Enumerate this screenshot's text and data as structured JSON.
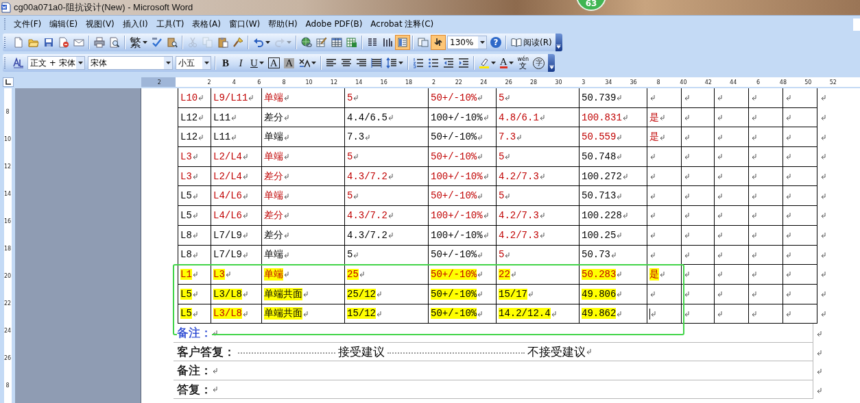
{
  "window": {
    "title": "cg00a071a0-阻抗设计(New) - Microsoft Word"
  },
  "badge": {
    "text": "63"
  },
  "menu": [
    "文件(F)",
    "编辑(E)",
    "视图(V)",
    "插入(I)",
    "工具(T)",
    "表格(A)",
    "窗口(W)",
    "帮助(H)",
    "Adobe PDF(B)",
    "Acrobat 注释(C)"
  ],
  "toolbar_standard": [
    {
      "kind": "new",
      "pressed": false,
      "disabled": false
    },
    {
      "kind": "open",
      "pressed": false,
      "disabled": false
    },
    {
      "kind": "save",
      "pressed": false,
      "disabled": false
    },
    {
      "kind": "permission",
      "pressed": false,
      "disabled": false
    },
    {
      "kind": "email",
      "pressed": false,
      "disabled": false
    },
    {
      "kind": "separator"
    },
    {
      "kind": "print",
      "pressed": false,
      "disabled": false
    },
    {
      "kind": "preview",
      "pressed": false,
      "disabled": false
    },
    {
      "kind": "separator"
    },
    {
      "kind": "glyph",
      "label": "繁",
      "dropdown": true,
      "pressed": false,
      "disabled": false
    },
    {
      "kind": "spell",
      "pressed": false,
      "disabled": false
    },
    {
      "kind": "research",
      "pressed": false,
      "disabled": false
    },
    {
      "kind": "separator"
    },
    {
      "kind": "cut",
      "pressed": false,
      "disabled": true
    },
    {
      "kind": "copy",
      "pressed": false,
      "disabled": true
    },
    {
      "kind": "paste",
      "pressed": false,
      "disabled": false
    },
    {
      "kind": "painter",
      "pressed": false,
      "disabled": false
    },
    {
      "kind": "separator"
    },
    {
      "kind": "undo",
      "dropdown": true,
      "pressed": false,
      "disabled": false
    },
    {
      "kind": "redo",
      "dropdown": true,
      "pressed": false,
      "disabled": true
    },
    {
      "kind": "separator"
    },
    {
      "kind": "hyperlink",
      "pressed": false,
      "disabled": false
    },
    {
      "kind": "tables",
      "pressed": false,
      "disabled": false
    },
    {
      "kind": "table",
      "pressed": false,
      "disabled": false
    },
    {
      "kind": "sheet",
      "pressed": false,
      "disabled": false
    },
    {
      "kind": "separator"
    },
    {
      "kind": "columns",
      "pressed": false,
      "disabled": false
    },
    {
      "kind": "drawing",
      "pressed": false,
      "disabled": false
    },
    {
      "kind": "docmap",
      "pressed": true,
      "disabled": false
    },
    {
      "kind": "separator"
    },
    {
      "kind": "thumbs",
      "pressed": false,
      "disabled": false
    },
    {
      "kind": "showhide",
      "pressed": true,
      "disabled": false
    },
    {
      "kind": "combo",
      "value": "130%"
    },
    {
      "kind": "help",
      "label": "?",
      "pressed": false,
      "disabled": false
    },
    {
      "kind": "separator"
    },
    {
      "kind": "read",
      "label": "阅读(R)",
      "pressed": false,
      "disabled": false
    }
  ],
  "toolbar_formatting": [
    {
      "kind": "styles"
    },
    {
      "kind": "combo",
      "value": "正文 + 宋体"
    },
    {
      "kind": "combo",
      "value": "宋体"
    },
    {
      "kind": "combo",
      "value": "小五"
    },
    {
      "kind": "separator"
    },
    {
      "kind": "bold",
      "label": "B"
    },
    {
      "kind": "italic",
      "label": "I"
    },
    {
      "kind": "underline",
      "label": "U",
      "dropdown": true
    },
    {
      "kind": "boxed",
      "label": "A"
    },
    {
      "kind": "shaded",
      "label": "A"
    },
    {
      "kind": "scale",
      "dropdown": true
    },
    {
      "kind": "separator"
    },
    {
      "kind": "left"
    },
    {
      "kind": "center"
    },
    {
      "kind": "right"
    },
    {
      "kind": "justify"
    },
    {
      "kind": "spacing",
      "dropdown": true
    },
    {
      "kind": "separator"
    },
    {
      "kind": "numbering"
    },
    {
      "kind": "bullets"
    },
    {
      "kind": "outdent"
    },
    {
      "kind": "indent"
    },
    {
      "kind": "separator"
    },
    {
      "kind": "highlight",
      "dropdown": true
    },
    {
      "kind": "fontcolor",
      "label": "A",
      "dropdown": true
    },
    {
      "kind": "phonetic",
      "top": "wén",
      "label": "文"
    },
    {
      "kind": "enclosed",
      "label": "字"
    }
  ],
  "ruler": {
    "labels": [
      "2",
      "2",
      "4",
      "6",
      "8",
      "10",
      "12",
      "14",
      "16",
      "18",
      "2",
      "22",
      "24",
      "26",
      "28",
      "30",
      "3",
      "34",
      "36",
      "8",
      "40",
      "42",
      "44",
      "6",
      "48",
      "50",
      "52"
    ]
  },
  "vertical_ruler": {
    "labels": [
      "8",
      "10",
      "12",
      "14",
      "16",
      "18",
      "20",
      "22",
      "24",
      "26",
      "8"
    ]
  },
  "table": {
    "formatting_marks": true,
    "rows": [
      {
        "cells": [
          {
            "kind": "text",
            "text": "L10",
            "red": true,
            "highlight": false
          },
          {
            "kind": "text",
            "text": "L9/L11",
            "red": true,
            "highlight": false
          },
          {
            "kind": "text",
            "text": "单端",
            "red": true,
            "highlight": false
          },
          {
            "kind": "text",
            "text": "5",
            "red": true,
            "highlight": false
          },
          {
            "kind": "text",
            "text": "50+/-10%",
            "red": true,
            "highlight": false
          },
          {
            "kind": "text",
            "text": "5",
            "red": true,
            "highlight": false
          },
          {
            "kind": "text",
            "text": "50.739",
            "red": false,
            "highlight": false
          },
          {
            "kind": "blank"
          },
          {
            "kind": "blank"
          },
          {
            "kind": "blank"
          },
          {
            "kind": "blank"
          },
          {
            "kind": "blank"
          }
        ]
      },
      {
        "cells": [
          {
            "kind": "text",
            "text": "L12",
            "red": false,
            "highlight": false
          },
          {
            "kind": "text",
            "text": "L11",
            "red": false,
            "highlight": false
          },
          {
            "kind": "text",
            "text": "差分",
            "red": false,
            "highlight": false
          },
          {
            "kind": "text",
            "text": "4.4/6.5",
            "red": false,
            "highlight": false
          },
          {
            "kind": "text",
            "text": "100+/-10%",
            "red": false,
            "highlight": false
          },
          {
            "kind": "text",
            "text": "4.8/6.1",
            "red": true,
            "highlight": false
          },
          {
            "kind": "text",
            "text": "100.831",
            "red": true,
            "highlight": false
          },
          {
            "kind": "text",
            "text": "是",
            "red": true,
            "highlight": false
          },
          {
            "kind": "blank"
          },
          {
            "kind": "blank"
          },
          {
            "kind": "blank"
          },
          {
            "kind": "blank"
          }
        ]
      },
      {
        "cells": [
          {
            "kind": "text",
            "text": "L12",
            "red": false,
            "highlight": false
          },
          {
            "kind": "text",
            "text": "L11",
            "red": false,
            "highlight": false
          },
          {
            "kind": "text",
            "text": "单端",
            "red": false,
            "highlight": false
          },
          {
            "kind": "text",
            "text": "7.3",
            "red": false,
            "highlight": false
          },
          {
            "kind": "text",
            "text": "50+/-10%",
            "red": false,
            "highlight": false
          },
          {
            "kind": "text",
            "text": "7.3",
            "red": true,
            "highlight": false
          },
          {
            "kind": "text",
            "text": "50.559",
            "red": true,
            "highlight": false
          },
          {
            "kind": "text",
            "text": "是",
            "red": true,
            "highlight": false
          },
          {
            "kind": "blank"
          },
          {
            "kind": "blank"
          },
          {
            "kind": "blank"
          },
          {
            "kind": "blank"
          }
        ]
      },
      {
        "cells": [
          {
            "kind": "text",
            "text": "L3",
            "red": true,
            "highlight": false
          },
          {
            "kind": "text",
            "text": "L2/L4",
            "red": true,
            "highlight": false
          },
          {
            "kind": "text",
            "text": "单端",
            "red": true,
            "highlight": false
          },
          {
            "kind": "text",
            "text": "5",
            "red": true,
            "highlight": false
          },
          {
            "kind": "text",
            "text": "50+/-10%",
            "red": true,
            "highlight": false
          },
          {
            "kind": "text",
            "text": "5",
            "red": true,
            "highlight": false
          },
          {
            "kind": "text",
            "text": "50.748",
            "red": false,
            "highlight": false
          },
          {
            "kind": "blank"
          },
          {
            "kind": "blank"
          },
          {
            "kind": "blank"
          },
          {
            "kind": "blank"
          },
          {
            "kind": "blank"
          }
        ]
      },
      {
        "cells": [
          {
            "kind": "text",
            "text": "L3",
            "red": true,
            "highlight": false
          },
          {
            "kind": "text",
            "text": "L2/L4",
            "red": true,
            "highlight": false
          },
          {
            "kind": "text",
            "text": "差分",
            "red": true,
            "highlight": false
          },
          {
            "kind": "text",
            "text": "4.3/7.2",
            "red": true,
            "highlight": false
          },
          {
            "kind": "text",
            "text": "100+/-10%",
            "red": true,
            "highlight": false
          },
          {
            "kind": "text",
            "text": "4.2/7.3",
            "red": true,
            "highlight": false
          },
          {
            "kind": "text",
            "text": "100.272",
            "red": false,
            "highlight": false
          },
          {
            "kind": "blank"
          },
          {
            "kind": "blank"
          },
          {
            "kind": "blank"
          },
          {
            "kind": "blank"
          },
          {
            "kind": "blank"
          }
        ]
      },
      {
        "cells": [
          {
            "kind": "text",
            "text": "L5",
            "red": false,
            "highlight": false
          },
          {
            "kind": "text",
            "text": "L4/L6",
            "red": true,
            "highlight": false
          },
          {
            "kind": "text",
            "text": "单端",
            "red": true,
            "highlight": false
          },
          {
            "kind": "text",
            "text": "5",
            "red": true,
            "highlight": false
          },
          {
            "kind": "text",
            "text": "50+/-10%",
            "red": true,
            "highlight": false
          },
          {
            "kind": "text",
            "text": "5",
            "red": true,
            "highlight": false
          },
          {
            "kind": "text",
            "text": "50.713",
            "red": false,
            "highlight": false
          },
          {
            "kind": "blank"
          },
          {
            "kind": "blank"
          },
          {
            "kind": "blank"
          },
          {
            "kind": "blank"
          },
          {
            "kind": "blank"
          }
        ]
      },
      {
        "cells": [
          {
            "kind": "text",
            "text": "L5",
            "red": false,
            "highlight": false
          },
          {
            "kind": "text",
            "text": "L4/L6",
            "red": true,
            "highlight": false
          },
          {
            "kind": "text",
            "text": "差分",
            "red": true,
            "highlight": false
          },
          {
            "kind": "text",
            "text": "4.3/7.2",
            "red": true,
            "highlight": false
          },
          {
            "kind": "text",
            "text": "100+/-10%",
            "red": true,
            "highlight": false
          },
          {
            "kind": "text",
            "text": "4.2/7.3",
            "red": true,
            "highlight": false
          },
          {
            "kind": "text",
            "text": "100.228",
            "red": false,
            "highlight": false
          },
          {
            "kind": "blank"
          },
          {
            "kind": "blank"
          },
          {
            "kind": "blank"
          },
          {
            "kind": "blank"
          },
          {
            "kind": "blank"
          }
        ]
      },
      {
        "cells": [
          {
            "kind": "text",
            "text": "L8",
            "red": false,
            "highlight": false
          },
          {
            "kind": "text",
            "text": "L7/L9",
            "red": false,
            "highlight": false
          },
          {
            "kind": "text",
            "text": "差分",
            "red": false,
            "highlight": false
          },
          {
            "kind": "text",
            "text": "4.3/7.2",
            "red": false,
            "highlight": false
          },
          {
            "kind": "text",
            "text": "100+/-10%",
            "red": false,
            "highlight": false
          },
          {
            "kind": "text",
            "text": "4.2/7.3",
            "red": true,
            "highlight": false
          },
          {
            "kind": "text",
            "text": "100.25",
            "red": false,
            "highlight": false
          },
          {
            "kind": "blank"
          },
          {
            "kind": "blank"
          },
          {
            "kind": "blank"
          },
          {
            "kind": "blank"
          },
          {
            "kind": "blank"
          }
        ]
      },
      {
        "cells": [
          {
            "kind": "text",
            "text": "L8",
            "red": false,
            "highlight": false
          },
          {
            "kind": "text",
            "text": "L7/L9",
            "red": false,
            "highlight": false
          },
          {
            "kind": "text",
            "text": "单端",
            "red": false,
            "highlight": false
          },
          {
            "kind": "text",
            "text": "5",
            "red": false,
            "highlight": false
          },
          {
            "kind": "text",
            "text": "50+/-10%",
            "red": false,
            "highlight": false
          },
          {
            "kind": "text",
            "text": "5",
            "red": true,
            "highlight": false
          },
          {
            "kind": "text",
            "text": "50.73",
            "red": false,
            "highlight": false
          },
          {
            "kind": "blank"
          },
          {
            "kind": "blank"
          },
          {
            "kind": "blank"
          },
          {
            "kind": "blank"
          },
          {
            "kind": "blank"
          }
        ]
      },
      {
        "cells": [
          {
            "kind": "text",
            "text": "L1",
            "red": true,
            "highlight": true
          },
          {
            "kind": "text",
            "text": "L3",
            "red": true,
            "highlight": true
          },
          {
            "kind": "text",
            "text": "单端",
            "red": true,
            "highlight": true
          },
          {
            "kind": "text",
            "text": "25",
            "red": true,
            "highlight": true
          },
          {
            "kind": "text",
            "text": "50+/-10%",
            "red": true,
            "highlight": true
          },
          {
            "kind": "text",
            "text": "22",
            "red": true,
            "highlight": true
          },
          {
            "kind": "text",
            "text": "50.283",
            "red": true,
            "highlight": true
          },
          {
            "kind": "text",
            "text": "是",
            "red": true,
            "highlight": true
          },
          {
            "kind": "blank"
          },
          {
            "kind": "blank"
          },
          {
            "kind": "blank"
          },
          {
            "kind": "blank"
          }
        ]
      },
      {
        "cells": [
          {
            "kind": "text",
            "text": "L5",
            "red": false,
            "highlight": true
          },
          {
            "kind": "text",
            "text": "L3/L8",
            "red": false,
            "highlight": true
          },
          {
            "kind": "text",
            "text": "单端共面",
            "red": false,
            "highlight": true
          },
          {
            "kind": "text",
            "text": "25/12",
            "red": false,
            "highlight": true
          },
          {
            "kind": "text",
            "text": "50+/-10%",
            "red": false,
            "highlight": true
          },
          {
            "kind": "text",
            "text": "15/17",
            "red": false,
            "highlight": true
          },
          {
            "kind": "text",
            "text": "49.806",
            "red": false,
            "highlight": true
          },
          {
            "kind": "blank"
          },
          {
            "kind": "blank"
          },
          {
            "kind": "blank"
          },
          {
            "kind": "blank"
          },
          {
            "kind": "blank"
          }
        ]
      },
      {
        "cells": [
          {
            "kind": "text",
            "text": "L5",
            "red": false,
            "highlight": true
          },
          {
            "kind": "text",
            "text": "L3/L8",
            "red": true,
            "highlight": true
          },
          {
            "kind": "text",
            "text": "单端共面",
            "red": false,
            "highlight": true
          },
          {
            "kind": "text",
            "text": "15/12",
            "red": false,
            "highlight": true
          },
          {
            "kind": "text",
            "text": "50+/-10%",
            "red": false,
            "highlight": true
          },
          {
            "kind": "text",
            "text": "14.2/12.4",
            "red": false,
            "highlight": true
          },
          {
            "kind": "text",
            "text": "49.862",
            "red": false,
            "highlight": true
          },
          {
            "kind": "cursor"
          },
          {
            "kind": "blank"
          },
          {
            "kind": "blank"
          },
          {
            "kind": "blank"
          },
          {
            "kind": "blank"
          }
        ]
      }
    ]
  },
  "notes": [
    {
      "text": "备注：",
      "color": "#1f3fd0"
    },
    {
      "text": "客户答复：",
      "color": "#000000",
      "options": [
        "接受建议",
        "不接受建议"
      ]
    },
    {
      "text": "备注：",
      "color": "#000000"
    },
    {
      "text": "答复：",
      "color": "#000000"
    }
  ]
}
